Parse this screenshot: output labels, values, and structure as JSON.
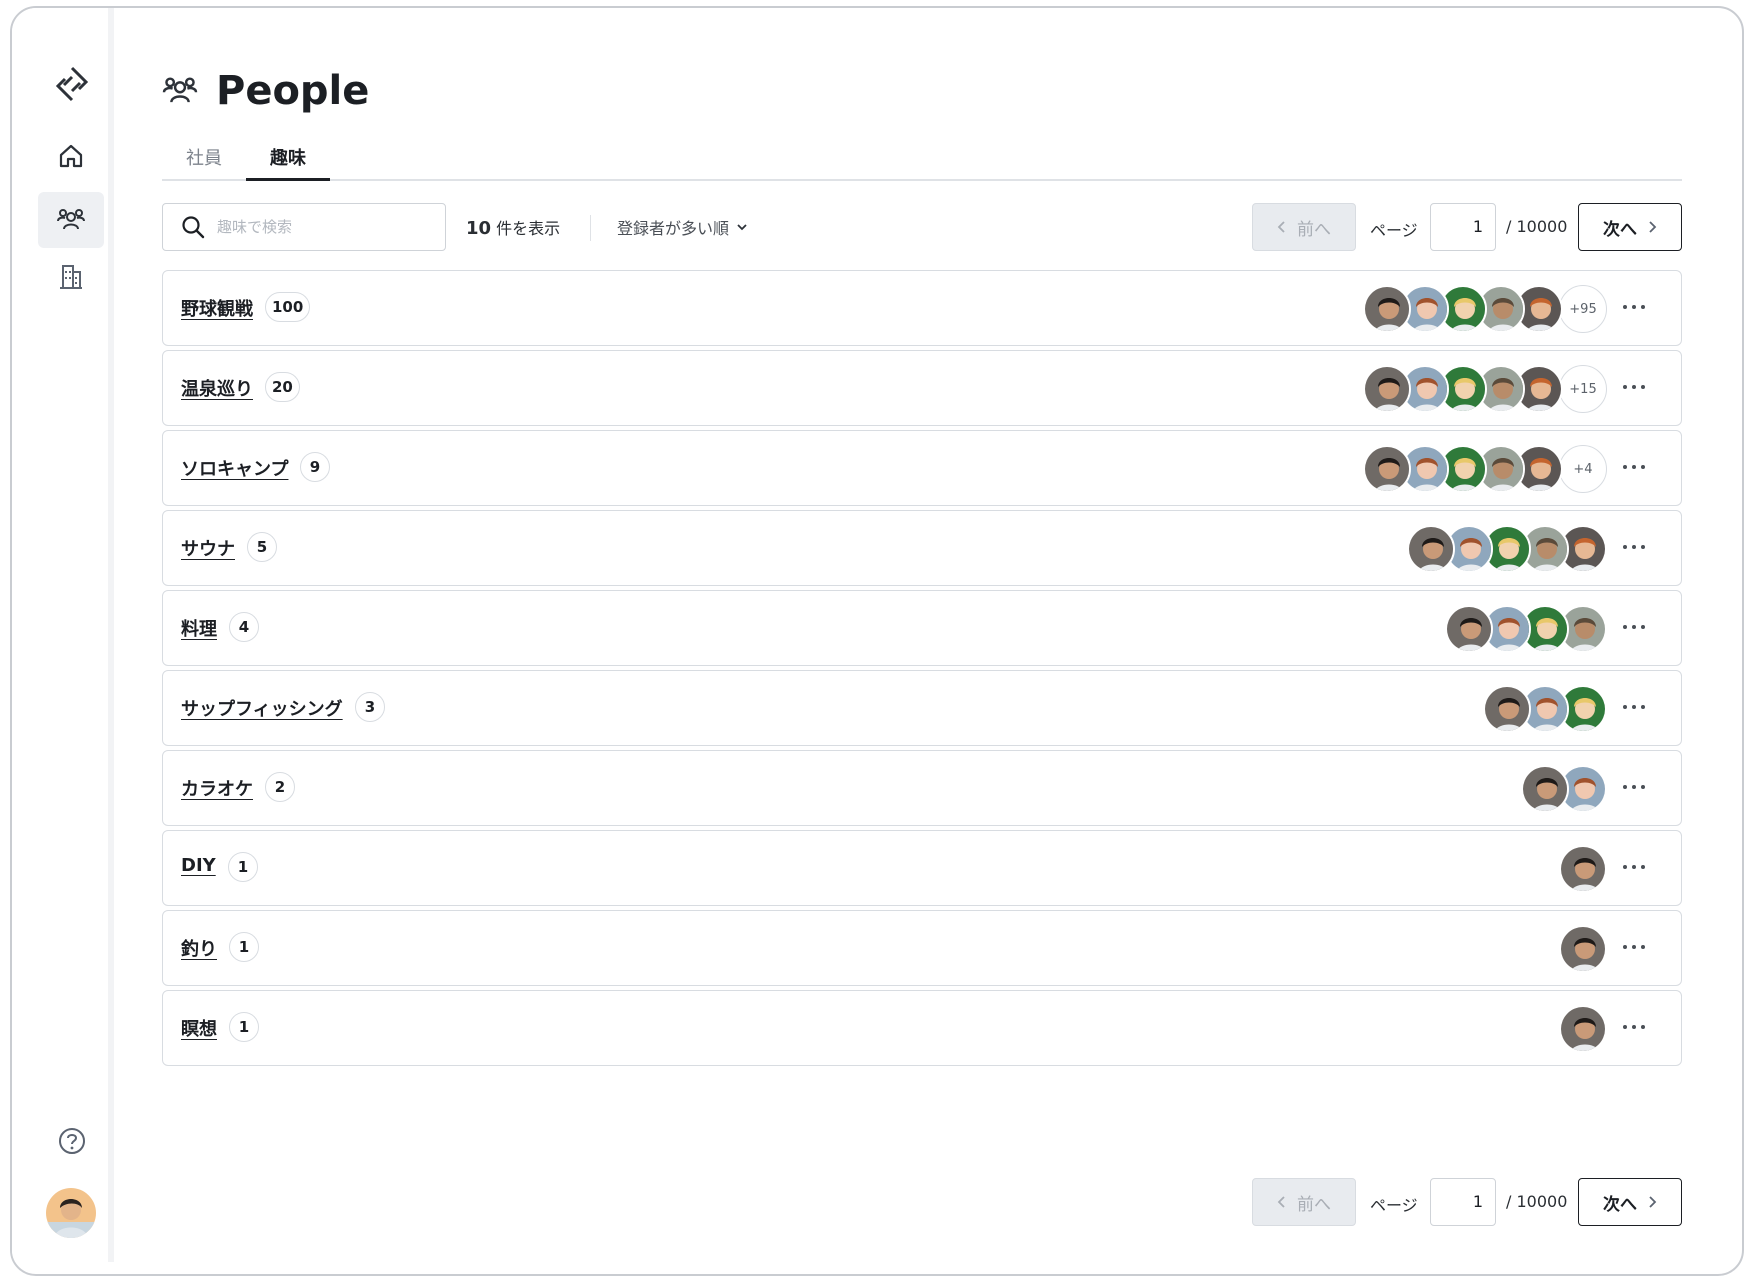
{
  "app": {
    "page_title": "People",
    "tabs": [
      {
        "label": "社員",
        "active": false
      },
      {
        "label": "趣味",
        "active": true
      }
    ]
  },
  "sidebar": {
    "items": [
      {
        "icon": "home-icon"
      },
      {
        "icon": "people-icon",
        "active": true
      },
      {
        "icon": "building-icon"
      }
    ]
  },
  "toolbar": {
    "search_placeholder": "趣味で検索",
    "count_number": "10",
    "count_suffix": "件を表示",
    "sort_label": "登録者が多い順"
  },
  "pagination": {
    "prev_label": "前へ",
    "page_label": "ページ",
    "current_page": "1",
    "total_pages": "/ 10000",
    "next_label": "次へ"
  },
  "hobbies": [
    {
      "name": "野球観戦",
      "count": "100",
      "avatars": 5,
      "more": "+95"
    },
    {
      "name": "温泉巡り",
      "count": "20",
      "avatars": 5,
      "more": "+15"
    },
    {
      "name": "ソロキャンプ",
      "count": "9",
      "avatars": 5,
      "more": "+4"
    },
    {
      "name": "サウナ",
      "count": "5",
      "avatars": 5,
      "more": ""
    },
    {
      "name": "料理",
      "count": "4",
      "avatars": 4,
      "more": ""
    },
    {
      "name": "サップフィッシング",
      "count": "3",
      "avatars": 3,
      "more": ""
    },
    {
      "name": "カラオケ",
      "count": "2",
      "avatars": 2,
      "more": ""
    },
    {
      "name": "DIY",
      "count": "1",
      "avatars": 1,
      "more": ""
    },
    {
      "name": "釣り",
      "count": "1",
      "avatars": 1,
      "more": ""
    },
    {
      "name": "瞑想",
      "count": "1",
      "avatars": 1,
      "more": ""
    }
  ]
}
